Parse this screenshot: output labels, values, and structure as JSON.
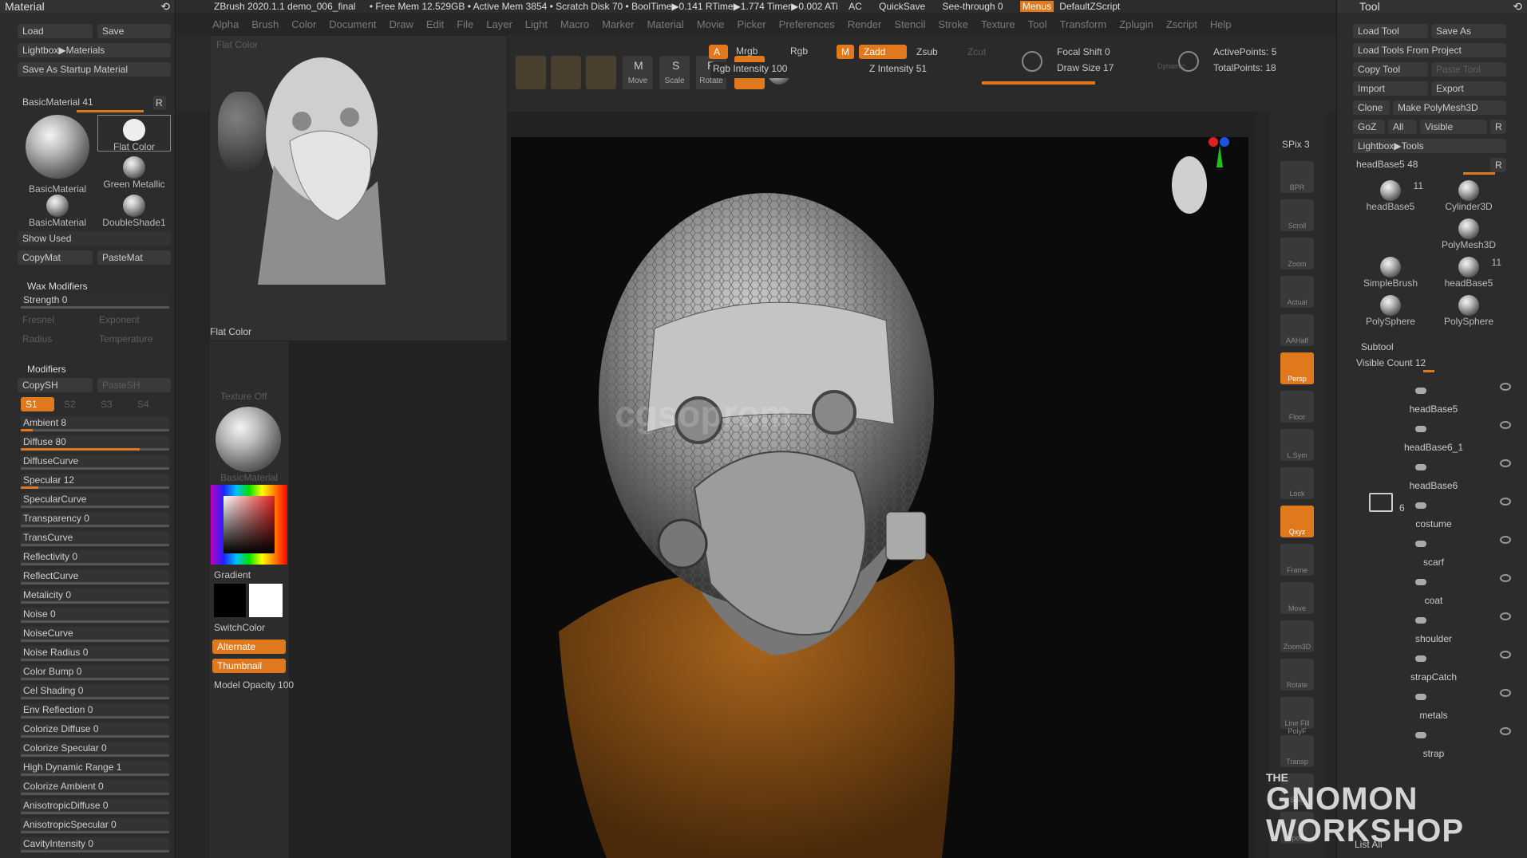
{
  "app": {
    "title_bar": "ZBrush 2020.1.1 demo_006_final",
    "stats": "• Free Mem 12.529GB • Active Mem 3854 • Scratch Disk 70 • BoolTime▶0.141 RTime▶1.774 Timer▶0.002 ATi",
    "ac": "AC",
    "quicksave": "QuickSave",
    "seethrough": "See-through",
    "seethrough_val": "0",
    "menus": "Menus",
    "defaultzscript": "DefaultZScript"
  },
  "menubar": {
    "items": [
      "Alpha",
      "Brush",
      "Color",
      "Document",
      "Draw",
      "Edit",
      "File",
      "Layer",
      "Light",
      "Macro",
      "Marker",
      "Material",
      "Movie",
      "Picker",
      "Preferences",
      "Render",
      "Stencil",
      "Stroke",
      "Texture",
      "Tool",
      "Transform",
      "Zplugin",
      "Zscript",
      "Help"
    ]
  },
  "material": {
    "title": "Material",
    "load": "Load",
    "save": "Save",
    "lightbox": "Lightbox▶Materials",
    "save_startup": "Save As Startup Material",
    "basic_label": "BasicMaterial",
    "basic_val": "41",
    "r": "R",
    "swatches": [
      "BasicMaterial",
      "Flat Color",
      "Green Metallic",
      "BasicMaterial",
      "DoubleShade1"
    ],
    "show_used": "Show Used",
    "copymat": "CopyMat",
    "pastemat": "PasteMat",
    "wax_header": "Wax Modifiers",
    "wax_strength": "Strength 0",
    "wax_dim": [
      "Fresnel",
      "Exponent",
      "Radius",
      "Temperature"
    ],
    "modifiers_header": "Modifiers",
    "copysh": "CopySH",
    "pastesh": "PasteSH",
    "s_tabs": [
      "S1",
      "S2",
      "S3",
      "S4"
    ],
    "sliders": [
      {
        "label": "Ambient 8",
        "level": 0.08
      },
      {
        "label": "Diffuse 80",
        "level": 0.8
      },
      {
        "label": "DiffuseCurve",
        "level": 0
      },
      {
        "label": "Specular 12",
        "level": 0.12
      },
      {
        "label": "SpecularCurve",
        "level": 0
      },
      {
        "label": "Transparency 0",
        "level": 0
      },
      {
        "label": "TransCurve",
        "level": 0
      },
      {
        "label": "Reflectivity 0",
        "level": 0
      },
      {
        "label": "ReflectCurve",
        "level": 0
      },
      {
        "label": "Metalicity 0",
        "level": 0
      },
      {
        "label": "Noise 0",
        "level": 0
      },
      {
        "label": "NoiseCurve",
        "level": 0
      },
      {
        "label": "Noise Radius 0",
        "level": 0
      },
      {
        "label": "Color Bump 0",
        "level": 0
      },
      {
        "label": "Cel Shading 0",
        "level": 0
      },
      {
        "label": "Env Reflection 0",
        "level": 0
      },
      {
        "label": "Colorize Diffuse 0",
        "level": 0
      },
      {
        "label": "Colorize Specular 0",
        "level": 0
      },
      {
        "label": "High Dynamic Range 1",
        "level": 0
      },
      {
        "label": "Colorize Ambient 0",
        "level": 0
      },
      {
        "label": "AnisotropicDiffuse 0",
        "level": 0
      },
      {
        "label": "AnisotropicSpecular 0",
        "level": 0
      },
      {
        "label": "CavityIntensity 0",
        "level": 0
      }
    ]
  },
  "popup": {
    "title": "Flat Color",
    "sub": "Flat Color",
    "texture_off": "Texture Off",
    "mat_label": "BasicMaterial",
    "gradient": "Gradient",
    "switchcolor": "SwitchColor",
    "alternate": "Alternate",
    "thumbnail": "Thumbnail",
    "model_opacity": "Model Opacity 100"
  },
  "shelf": {
    "tools": [
      "Move",
      "Scale",
      "Rotate"
    ],
    "a": "A",
    "mrgb": "Mrgb",
    "rgb": "Rgb",
    "m": "M",
    "zadd": "Zadd",
    "zsub": "Zsub",
    "zcut": "Zcut",
    "rgb_intensity": "Rgb Intensity 100",
    "z_intensity": "Z Intensity 51",
    "focal_shift": "Focal Shift 0",
    "draw_size": "Draw Size 17",
    "dynamic": "Dynamic",
    "active_points": "ActivePoints: 5",
    "total_points": "TotalPoints: 18"
  },
  "rightstrip": {
    "spix": "SPix 3",
    "buttons": [
      "BPR",
      "Scroll",
      "Zoom",
      "Actual",
      "AAHalf",
      "Persp",
      "Floor",
      "L.Sym",
      "Lock",
      "Qxyz",
      "Frame",
      "Move",
      "Zoom3D",
      "Rotate",
      "Line Fill PolyF",
      "Transp",
      "Solo",
      "Xpose"
    ]
  },
  "tool": {
    "title": "Tool",
    "load_tool": "Load Tool",
    "save_as": "Save As",
    "load_from_project": "Load Tools From Project",
    "copy_tool": "Copy Tool",
    "paste_tool": "Paste Tool",
    "import": "Import",
    "export": "Export",
    "clone": "Clone",
    "make_polymesh": "Make PolyMesh3D",
    "goz": "GoZ",
    "all": "All",
    "visible": "Visible",
    "r": "R",
    "lightbox_tools": "Lightbox▶Tools",
    "current": "headBase5",
    "current_val": "48",
    "thumbs": [
      {
        "name": "headBase5",
        "count": "11"
      },
      {
        "name": "Cylinder3D",
        "count": ""
      },
      {
        "name": "PolyMesh3D",
        "count": ""
      },
      {
        "name": "SimpleBrush",
        "count": ""
      },
      {
        "name": "headBase5",
        "count": "11"
      },
      {
        "name": "PolySphere",
        "count": ""
      },
      {
        "name": "PolySphere",
        "count": ""
      }
    ],
    "subtool_header": "Subtool",
    "visible_count": "Visible Count 12",
    "subtools": [
      "headBase5",
      "headBase6_1",
      "headBase6",
      "costume",
      "scarf",
      "coat",
      "shoulder",
      "strapCatch",
      "metals",
      "strap"
    ],
    "folder_count": "6",
    "list_all": "List All"
  },
  "watermark": {
    "center": "cgsoprom",
    "the": "THE",
    "gnomon": "GNOMON",
    "workshop": "WORKSHOP"
  }
}
